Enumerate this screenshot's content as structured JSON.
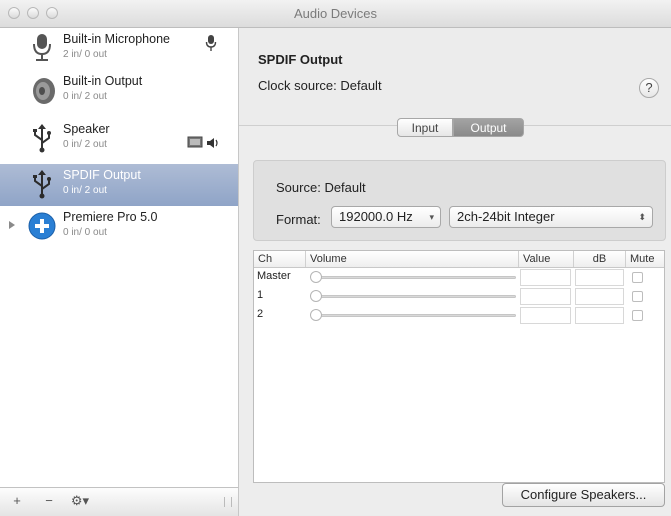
{
  "window": {
    "title": "Audio Devices"
  },
  "devices": [
    {
      "name": "Built-in Microphone",
      "io": "2 in/ 0 out",
      "icon": "microphone-icon",
      "badge": "microphone-badge-icon"
    },
    {
      "name": "Built-in Output",
      "io": "0 in/ 2 out",
      "icon": "speaker-icon"
    },
    {
      "name": "Speaker",
      "io": "0 in/ 2 out",
      "icon": "usb-icon",
      "badge": "screen-and-speaker-badge-icon"
    },
    {
      "name": "SPDIF Output",
      "io": "0 in/ 2 out",
      "icon": "usb-icon",
      "selected": true
    },
    {
      "name": "Premiere Pro 5.0",
      "io": "0 in/ 0 out",
      "icon": "aggregate-plus-icon",
      "expandable": true
    }
  ],
  "sidebar_toolbar": {
    "add": "+",
    "remove": "−",
    "gear": "⚙▾"
  },
  "detail": {
    "title": "SPDIF Output",
    "clock_source": "Clock source: Default",
    "help": "?",
    "tabs": [
      {
        "label": "Input"
      },
      {
        "label": "Output",
        "selected": true
      }
    ],
    "source_label": "Source:",
    "source_value": "Default",
    "format_label": "Format:",
    "format_rate": "192000.0 Hz",
    "format_depth": "2ch-24bit Integer"
  },
  "table": {
    "headers": [
      "Ch",
      "Volume",
      "Value",
      "dB",
      "Mute"
    ],
    "rows": [
      {
        "ch": "Master"
      },
      {
        "ch": "1"
      },
      {
        "ch": "2"
      }
    ]
  },
  "configure_speakers": "Configure Speakers..."
}
